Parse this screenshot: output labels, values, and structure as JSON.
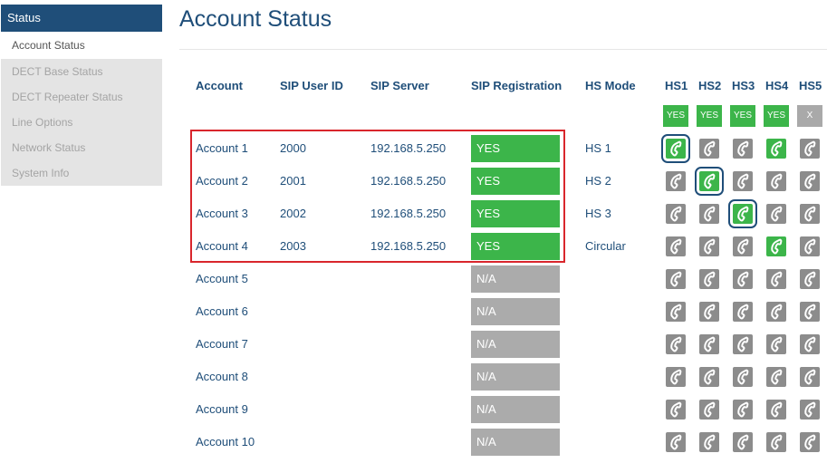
{
  "sidebar": {
    "header": "Status",
    "items": [
      {
        "label": "Account Status",
        "active": true
      },
      {
        "label": "DECT Base Status",
        "active": false
      },
      {
        "label": "DECT Repeater Status",
        "active": false
      },
      {
        "label": "Line Options",
        "active": false
      },
      {
        "label": "Network Status",
        "active": false
      },
      {
        "label": "System Info",
        "active": false
      }
    ]
  },
  "page": {
    "title": "Account Status"
  },
  "table": {
    "headers": {
      "account": "Account",
      "sip_user_id": "SIP User ID",
      "sip_server": "SIP Server",
      "sip_registration": "SIP Registration",
      "hs_mode": "HS Mode",
      "hs": [
        "HS1",
        "HS2",
        "HS3",
        "HS4",
        "HS5"
      ]
    },
    "hs_status": [
      "YES",
      "YES",
      "YES",
      "YES",
      "X"
    ],
    "rows": [
      {
        "account": "Account 1",
        "sip_user_id": "2000",
        "sip_server": "192.168.5.250",
        "registration": "YES",
        "hs_mode": "HS 1",
        "hs": [
          "sel-green",
          "grey",
          "grey",
          "green",
          "grey"
        ]
      },
      {
        "account": "Account 2",
        "sip_user_id": "2001",
        "sip_server": "192.168.5.250",
        "registration": "YES",
        "hs_mode": "HS 2",
        "hs": [
          "grey",
          "sel-green",
          "grey",
          "grey",
          "grey"
        ]
      },
      {
        "account": "Account 3",
        "sip_user_id": "2002",
        "sip_server": "192.168.5.250",
        "registration": "YES",
        "hs_mode": "HS 3",
        "hs": [
          "grey",
          "grey",
          "sel-green",
          "grey",
          "grey"
        ]
      },
      {
        "account": "Account 4",
        "sip_user_id": "2003",
        "sip_server": "192.168.5.250",
        "registration": "YES",
        "hs_mode": "Circular",
        "hs": [
          "grey",
          "grey",
          "grey",
          "green",
          "grey"
        ]
      },
      {
        "account": "Account 5",
        "sip_user_id": "",
        "sip_server": "",
        "registration": "N/A",
        "hs_mode": "",
        "hs": [
          "grey",
          "grey",
          "grey",
          "grey",
          "grey"
        ]
      },
      {
        "account": "Account 6",
        "sip_user_id": "",
        "sip_server": "",
        "registration": "N/A",
        "hs_mode": "",
        "hs": [
          "grey",
          "grey",
          "grey",
          "grey",
          "grey"
        ]
      },
      {
        "account": "Account 7",
        "sip_user_id": "",
        "sip_server": "",
        "registration": "N/A",
        "hs_mode": "",
        "hs": [
          "grey",
          "grey",
          "grey",
          "grey",
          "grey"
        ]
      },
      {
        "account": "Account 8",
        "sip_user_id": "",
        "sip_server": "",
        "registration": "N/A",
        "hs_mode": "",
        "hs": [
          "grey",
          "grey",
          "grey",
          "grey",
          "grey"
        ]
      },
      {
        "account": "Account 9",
        "sip_user_id": "",
        "sip_server": "",
        "registration": "N/A",
        "hs_mode": "",
        "hs": [
          "grey",
          "grey",
          "grey",
          "grey",
          "grey"
        ]
      },
      {
        "account": "Account 10",
        "sip_user_id": "",
        "sip_server": "",
        "registration": "N/A",
        "hs_mode": "",
        "hs": [
          "grey",
          "grey",
          "grey",
          "grey",
          "grey"
        ]
      }
    ]
  },
  "icons": {
    "handset": "phone-handset-icon"
  },
  "colors": {
    "brand": "#1f4e79",
    "registered": "#3cb54a",
    "unavailable": "#ababab",
    "highlight": "#d9262c"
  }
}
